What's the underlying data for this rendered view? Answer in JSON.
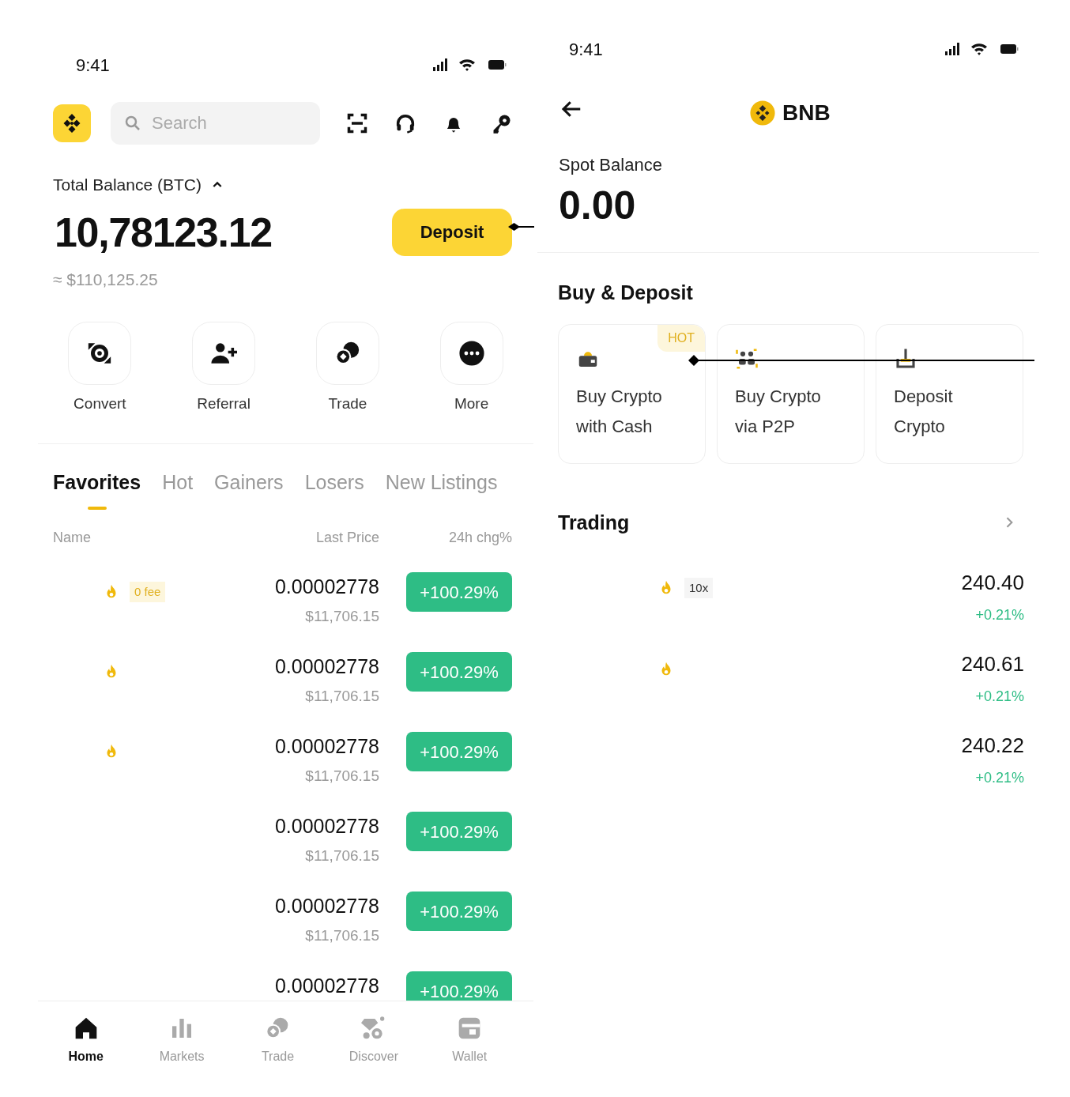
{
  "left_screen": {
    "status_bar": {
      "time": "9:41"
    },
    "search": {
      "placeholder": "Search"
    },
    "balance": {
      "label": "Total Balance (BTC)",
      "amount": "10,78123.12",
      "fiat": "≈ $110,125.25",
      "deposit_button": "Deposit"
    },
    "shortcuts": [
      {
        "kind": "convert",
        "label": "Convert"
      },
      {
        "kind": "referral",
        "label": "Referral"
      },
      {
        "kind": "trade",
        "label": "Trade"
      },
      {
        "kind": "more",
        "label": "More"
      }
    ],
    "tabs": [
      {
        "label": "Favorites",
        "selected": true
      },
      {
        "label": "Hot",
        "selected": false
      },
      {
        "label": "Gainers",
        "selected": false
      },
      {
        "label": "Losers",
        "selected": false
      },
      {
        "label": "New Listings",
        "selected": false
      }
    ],
    "columns": [
      "Name",
      "Last Price",
      "24h chg%"
    ],
    "rows": [
      {
        "hot": true,
        "tag": "0 fee",
        "price": "0.00002778",
        "fiat": "$11,706.15",
        "change": "+100.29%"
      },
      {
        "hot": true,
        "price": "0.00002778",
        "fiat": "$11,706.15",
        "change": "+100.29%"
      },
      {
        "hot": true,
        "price": "0.00002778",
        "fiat": "$11,706.15",
        "change": "+100.29%"
      },
      {
        "hot": false,
        "price": "0.00002778",
        "fiat": "$11,706.15",
        "change": "+100.29%"
      },
      {
        "hot": false,
        "price": "0.00002778",
        "fiat": "$11,706.15",
        "change": "+100.29%"
      },
      {
        "hot": false,
        "price": "0.00002778",
        "change": "+100.29%"
      }
    ],
    "bottom_nav": [
      {
        "kind": "home",
        "label": "Home",
        "selected": true
      },
      {
        "kind": "markets",
        "label": "Markets",
        "selected": false
      },
      {
        "kind": "trade",
        "label": "Trade",
        "selected": false
      },
      {
        "kind": "discover",
        "label": "Discover",
        "selected": false
      },
      {
        "kind": "wallet",
        "label": "Wallet",
        "selected": false
      }
    ]
  },
  "right_screen": {
    "status_bar": {
      "time": "9:41"
    },
    "title": "BNB",
    "spot": {
      "label": "Spot Balance",
      "amount": "0.00"
    },
    "buy_deposit": {
      "title": "Buy & Deposit",
      "cards": [
        {
          "kind": "cash",
          "lines": [
            "Buy Crypto",
            "with Cash"
          ],
          "badge": "HOT"
        },
        {
          "kind": "p2p",
          "lines": [
            "Buy Crypto",
            "via P2P"
          ]
        },
        {
          "kind": "deposit",
          "lines": [
            "Deposit",
            "Crypto"
          ]
        }
      ]
    },
    "trading": {
      "title": "Trading",
      "rows": [
        {
          "hot": true,
          "tag": "10x",
          "price": "240.40",
          "change": "+0.21%"
        },
        {
          "hot": true,
          "price": "240.61",
          "change": "+0.21%"
        },
        {
          "hot": false,
          "price": "240.22",
          "change": "+0.21%"
        }
      ]
    }
  }
}
